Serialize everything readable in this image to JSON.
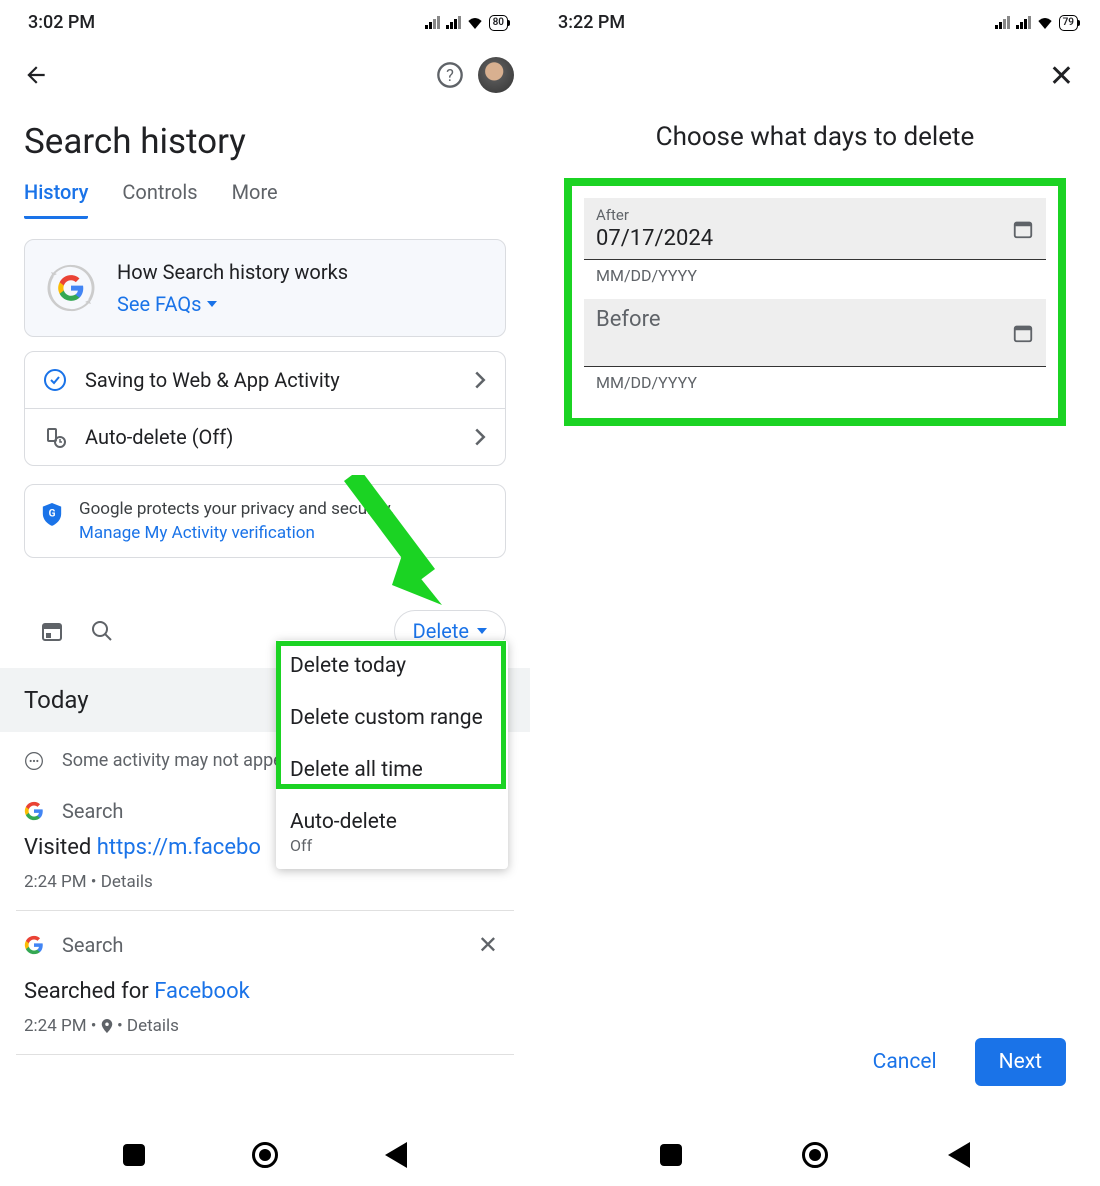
{
  "left": {
    "status": {
      "time": "3:02 PM",
      "battery": "80"
    },
    "page_title": "Search history",
    "tabs": [
      "History",
      "Controls",
      "More"
    ],
    "info_card": {
      "title": "How Search history works",
      "link": "See FAQs"
    },
    "settings": {
      "row1": "Saving to Web & App Activity",
      "row2": "Auto-delete (Off)"
    },
    "privacy": {
      "line1": "Google protects your privacy and security.",
      "link": "Manage My Activity verification"
    },
    "delete_button": "Delete",
    "popup": {
      "opt1": "Delete today",
      "opt2": "Delete custom range",
      "opt3": "Delete all time",
      "opt4": "Auto-delete",
      "opt4_sub": "Off"
    },
    "section_today": "Today",
    "note": "Some activity may not appe",
    "activity1": {
      "source": "Search",
      "prefix": "Visited ",
      "link": "https://m.facebo",
      "meta": "2:24 PM • Details"
    },
    "activity2": {
      "source": "Search",
      "prefix": "Searched for ",
      "link": "Facebook",
      "meta_time": "2:24 PM",
      "meta_details": "Details"
    }
  },
  "right": {
    "status": {
      "time": "3:22 PM",
      "battery": "79"
    },
    "title": "Choose what days to delete",
    "after": {
      "label": "After",
      "value": "07/17/2024",
      "hint": "MM/DD/YYYY"
    },
    "before": {
      "label": "Before",
      "value": "",
      "hint": "MM/DD/YYYY"
    },
    "cancel": "Cancel",
    "next": "Next"
  }
}
